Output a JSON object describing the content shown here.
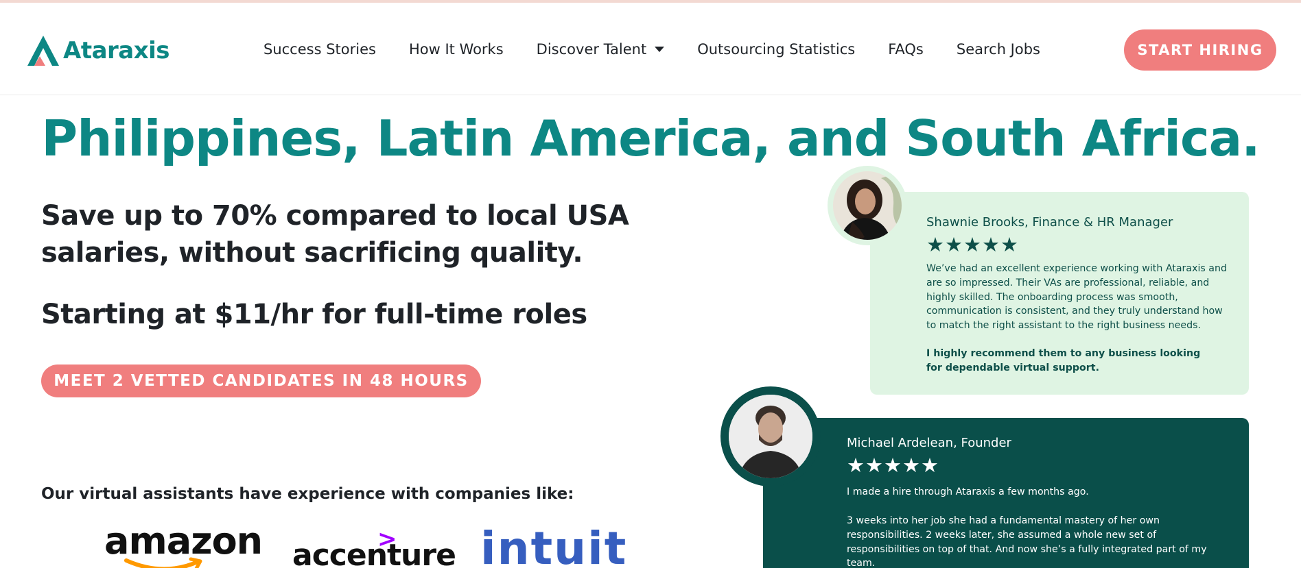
{
  "brand": {
    "name": "Ataraxis",
    "primary_color": "#0d8784",
    "accent_color": "#f07e7e",
    "dark_teal": "#0a4f4a",
    "light_green": "#dff4e3"
  },
  "nav": {
    "items": [
      {
        "label": "Success Stories"
      },
      {
        "label": "How It Works"
      },
      {
        "label": "Discover Talent",
        "has_dropdown": true
      },
      {
        "label": "Outsourcing Statistics"
      },
      {
        "label": "FAQs"
      },
      {
        "label": "Search Jobs"
      }
    ],
    "cta_label": "START HIRING"
  },
  "hero": {
    "headline": "Philippines, Latin America, and South Africa.",
    "subhead": "Save up to 70% compared to local USA salaries, without sacrificing quality.",
    "price_line": "Starting at $11/hr for full-time roles",
    "cta_label": "MEET 2 VETTED CANDIDATES IN 48 HOURS",
    "companies_label": "Our virtual assistants have experience with companies like:",
    "company_logos": [
      {
        "name": "amazon",
        "icon": "amazon-logo"
      },
      {
        "name": "accenture",
        "icon": "accenture-logo"
      },
      {
        "name": "intuit",
        "icon": "intuit-logo"
      }
    ]
  },
  "testimonials": [
    {
      "name": "Shawnie Brooks, Finance & HR Manager",
      "rating": 5,
      "stars": "★★★★★",
      "quote": "We’ve had an excellent experience working with Ataraxis and are so impressed. Their VAs are professional, reliable, and highly skilled. The onboarding process was smooth, communication is consistent, and they truly understand how to match the right assistant to the right business needs.",
      "quote_bold": "I highly recommend them to any business looking for dependable virtual support."
    },
    {
      "name": "Michael Ardelean, Founder",
      "rating": 5,
      "stars": "★★★★★",
      "quote_intro": "I made a hire through Ataraxis a few months ago.",
      "quote_body": "3 weeks into her job she had a fundamental mastery of her own responsibilities. 2 weeks later, she assumed a whole new set of responsibilities on top of that. And now she’s a fully integrated part of my team."
    }
  ]
}
